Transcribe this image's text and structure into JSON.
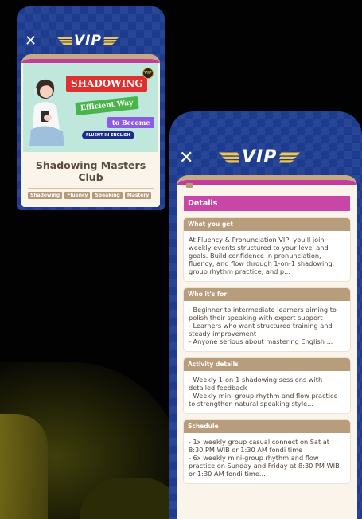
{
  "left_phone": {
    "close_glyph": "✕",
    "vip_label": "VIP",
    "card": {
      "image": {
        "headline": "SHADOWING",
        "subline": "Efficient Way",
        "to_become": "to Become",
        "pill": "FLUENT IN ENGLISH",
        "logo": "VIP"
      },
      "title": "Shadowing Masters Club",
      "tags": [
        "Shadowing",
        "Fluency",
        "Speaking",
        "Mastery"
      ]
    }
  },
  "right_phone": {
    "close_glyph": "✕",
    "vip_label": "VIP",
    "details_header": "Details",
    "sections": [
      {
        "title": "What you get",
        "body": "At Fluency & Pronunciation VIP, you'll join weekly events structured to your level and goals. Build confidence in pronunciation, fluency, and flow through 1-on-1 shadowing, group rhythm practice, and p..."
      },
      {
        "title": "Who it's for",
        "body": "- Beginner to intermediate learners aiming to polish their speaking with expert support\n- Learners who want structured training and steady improvement\n- Anyone serious about mastering English ..."
      },
      {
        "title": "Activity details",
        "body": "- Weekly 1-on-1 shadowing sessions with detailed feedback\n- Weekly mini-group rhythm and flow practice to strengthen natural speaking style..."
      },
      {
        "title": "Schedule",
        "body": "- 1x weekly group casual connect  on Sat at 8:30 PM WIB or 1:30 AM fondi time\n- 6x weekly mini-group rhythm and flow practice on Sunday and Friday at 8:30 PM WIB or 1:30 AM fondi time..."
      }
    ]
  },
  "colors": {
    "header_blue": "#1d3b8f",
    "accent_magenta": "#c847a6",
    "section_tan": "#b89d7d",
    "card_cream": "#fbf4ea"
  },
  "icons": {
    "close": "close-icon",
    "vip_wings": "vip-wing-icon"
  }
}
